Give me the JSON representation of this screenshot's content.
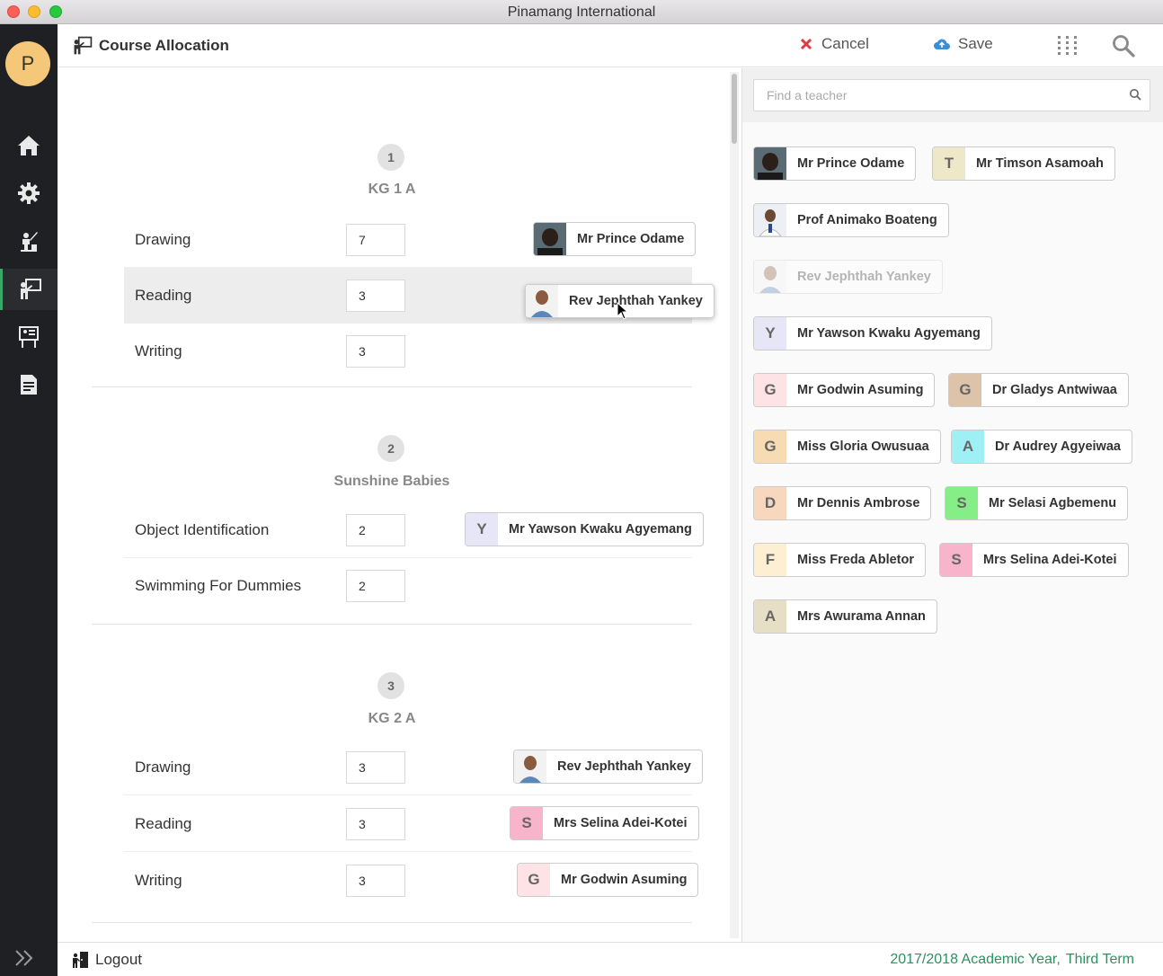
{
  "window": {
    "title": "Pinamang International"
  },
  "sidebar": {
    "avatar_initial": "P",
    "items": [
      {
        "name": "home-icon"
      },
      {
        "name": "gear-icon"
      },
      {
        "name": "teacher-icon"
      },
      {
        "name": "course-allocation-icon"
      },
      {
        "name": "board-icon"
      },
      {
        "name": "report-icon"
      }
    ]
  },
  "header": {
    "title": "Course Allocation",
    "cancel_label": "Cancel",
    "save_label": "Save"
  },
  "classes": [
    {
      "number": "1",
      "name": "KG 1 A",
      "courses": [
        {
          "name": "Drawing",
          "value": "7",
          "teacher": "Mr Prince Odame"
        },
        {
          "name": "Reading",
          "value": "3",
          "teacher": "Rev Jephthah Yankey"
        },
        {
          "name": "Writing",
          "value": "3",
          "teacher": ""
        }
      ]
    },
    {
      "number": "2",
      "name": "Sunshine Babies",
      "courses": [
        {
          "name": "Object Identification",
          "value": "2",
          "teacher": "Mr Yawson Kwaku Agyemang",
          "initial": "Y"
        },
        {
          "name": "Swimming For Dummies",
          "value": "2",
          "teacher": ""
        }
      ]
    },
    {
      "number": "3",
      "name": "KG 2 A",
      "courses": [
        {
          "name": "Drawing",
          "value": "3",
          "teacher": "Rev Jephthah Yankey"
        },
        {
          "name": "Reading",
          "value": "3",
          "teacher": "Mrs Selina Adei-Kotei",
          "initial": "S"
        },
        {
          "name": "Writing",
          "value": "3",
          "teacher": "Mr Godwin Asuming",
          "initial": "G"
        }
      ]
    }
  ],
  "teacher_panel": {
    "search_placeholder": "Find a teacher",
    "teachers": [
      {
        "name": "Mr Prince Odame",
        "initial": "",
        "color": "#3a3a3a"
      },
      {
        "name": "Mr Timson Asamoah",
        "initial": "T",
        "color": "#efe8c8"
      },
      {
        "name": "Prof Animako Boateng",
        "initial": "",
        "color": "#d9dde6"
      },
      {
        "name": "Rev Jephthah Yankey",
        "initial": "",
        "color": "#c9c9c9"
      },
      {
        "name": "Mr Yawson Kwaku Agyemang",
        "initial": "Y",
        "color": "#e6e6f7"
      },
      {
        "name": "Mr Godwin Asuming",
        "initial": "G",
        "color": "#fde3e6"
      },
      {
        "name": "Dr Gladys Antwiwaa",
        "initial": "G",
        "color": "#dcc3a9"
      },
      {
        "name": "Miss Gloria Owusuaa",
        "initial": "G",
        "color": "#f7dbb2"
      },
      {
        "name": "Dr Audrey Agyeiwaa",
        "initial": "A",
        "color": "#9ff0f5"
      },
      {
        "name": "Mr Dennis Ambrose",
        "initial": "D",
        "color": "#f7d7bd"
      },
      {
        "name": "Mr Selasi Agbemenu",
        "initial": "S",
        "color": "#86ee86"
      },
      {
        "name": "Miss Freda Abletor",
        "initial": "F",
        "color": "#fcefd2"
      },
      {
        "name": "Mrs Selina Adei-Kotei",
        "initial": "S",
        "color": "#f7b4cb"
      },
      {
        "name": "Mrs Awurama Annan",
        "initial": "A",
        "color": "#e6dfc5"
      }
    ]
  },
  "drag_chip": {
    "name": "Rev Jephthah Yankey"
  },
  "footer": {
    "logout_label": "Logout",
    "academic_year": "2017/2018 Academic Year,",
    "term": "Third Term"
  }
}
